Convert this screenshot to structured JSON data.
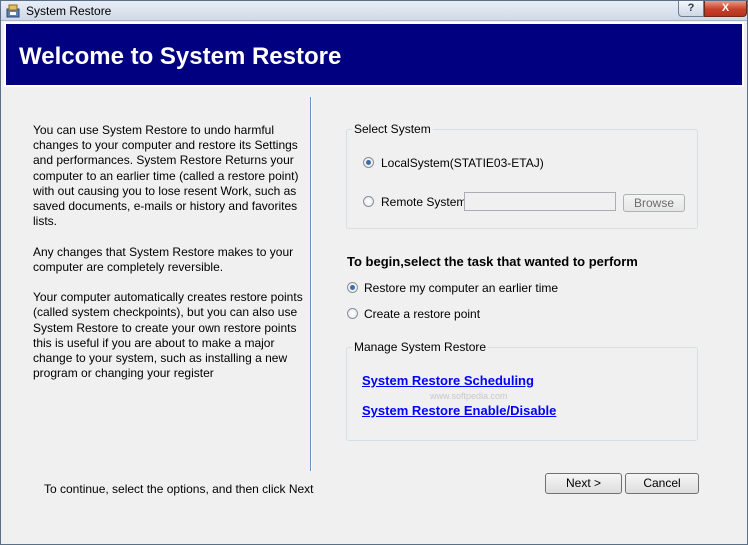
{
  "window": {
    "title": "System Restore",
    "help_glyph": "?",
    "close_glyph": "X"
  },
  "banner": {
    "title": "Welcome to System Restore"
  },
  "intro": {
    "paragraphs": [
      "You can use System Restore to undo harmful changes to your computer and restore its Settings and performances. System Restore Returns your computer to an earlier time (called a restore point) with out causing you to lose resent Work, such as saved documents, e-mails or history and favorites lists.",
      "Any changes that System Restore makes to your computer are completely reversible.",
      "Your computer automatically creates restore points (called system checkpoints), but you can also use System Restore to create your own restore points this is useful if you are about to make a major change to your system, such as installing a new program or changing your register"
    ],
    "footer_hint": "To continue, select the options, and then click Next"
  },
  "select_system": {
    "label": "Select System",
    "local_label": "LocalSystem(STATIE03-ETAJ)",
    "local_selected": true,
    "remote_label": "Remote System",
    "remote_selected": false,
    "remote_value": "",
    "browse_label": "Browse"
  },
  "task": {
    "heading": "To begin,select the task that wanted to perform",
    "restore_label": "Restore my computer an earlier time",
    "restore_selected": true,
    "create_label": "Create a restore point",
    "create_selected": false
  },
  "manage": {
    "label": "Manage System Restore",
    "scheduling_link": "System Restore Scheduling",
    "enable_link": "System Restore Enable/Disable"
  },
  "watermark": "www.softpedia.com",
  "buttons": {
    "next_label": "Next >",
    "cancel_label": "Cancel"
  },
  "colors": {
    "banner": "#000080",
    "link": "#0000ff",
    "divider": "#6f90c2"
  }
}
